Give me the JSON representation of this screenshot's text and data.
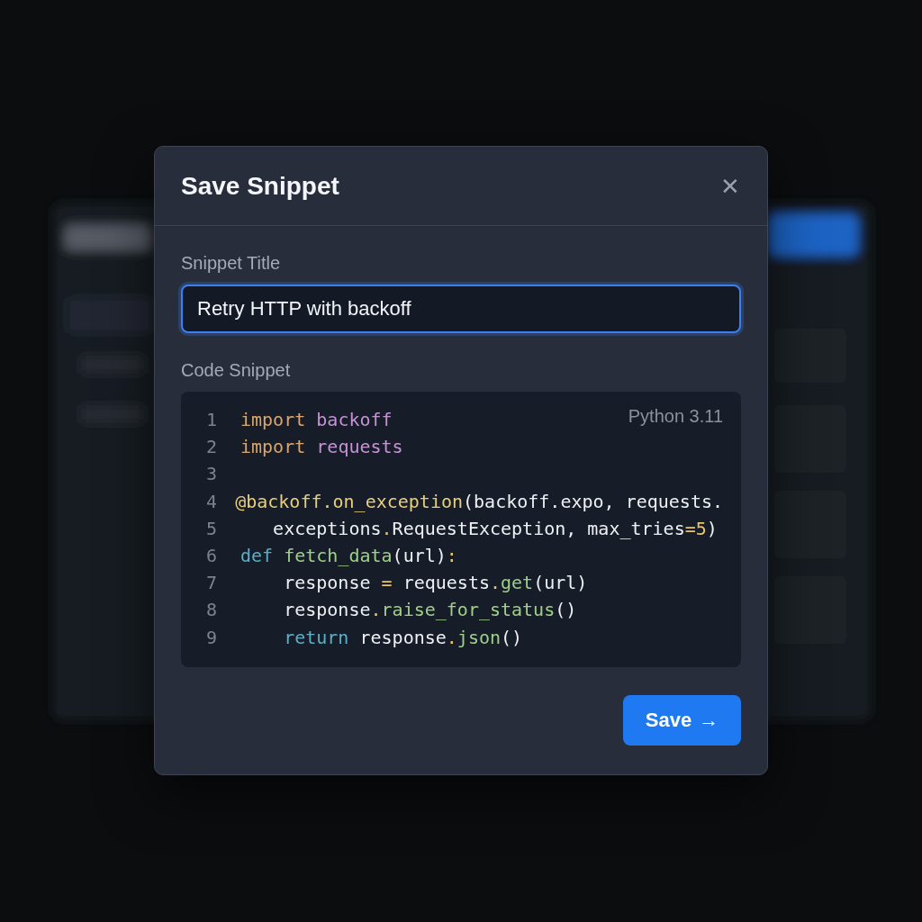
{
  "dialog": {
    "title": "Save Snippet",
    "close_label": "✕"
  },
  "title_field": {
    "label": "Snippet Title",
    "value": "Retry HTTP with backoff",
    "focused": true
  },
  "code_field": {
    "label": "Code Snippet",
    "language": "Python 3.11",
    "lines": [
      {
        "number": "1",
        "tokens": [
          {
            "kind": "keyword",
            "text": "import "
          },
          {
            "kind": "module",
            "text": "backoff"
          }
        ]
      },
      {
        "number": "2",
        "tokens": [
          {
            "kind": "keyword",
            "text": "import "
          },
          {
            "kind": "module",
            "text": "requests"
          }
        ]
      },
      {
        "number": "3"
      },
      {
        "number": "4",
        "tokens": [
          {
            "kind": "decorator",
            "text": "@backoff.on_exception"
          },
          {
            "kind": "plain",
            "text": "(backoff.expo, requests."
          }
        ]
      },
      {
        "number": "5",
        "tokens": [
          {
            "kind": "plain",
            "text": "   exceptions"
          },
          {
            "kind": "operator",
            "text": "."
          },
          {
            "kind": "plain",
            "text": "RequestException, max_tries"
          },
          {
            "kind": "operator",
            "text": "="
          },
          {
            "kind": "number",
            "text": "5"
          },
          {
            "kind": "plain",
            "text": ")"
          }
        ]
      },
      {
        "number": "6",
        "tokens": [
          {
            "kind": "control",
            "text": "def "
          },
          {
            "kind": "function",
            "text": "fetch_data"
          },
          {
            "kind": "plain",
            "text": "(url)"
          },
          {
            "kind": "operator",
            "text": ":"
          }
        ]
      },
      {
        "number": "7",
        "tokens": [
          {
            "kind": "plain",
            "text": "    response "
          },
          {
            "kind": "operator",
            "text": "="
          },
          {
            "kind": "plain",
            "text": " requests"
          },
          {
            "kind": "operator",
            "text": "."
          },
          {
            "kind": "function",
            "text": "get"
          },
          {
            "kind": "plain",
            "text": "(url)"
          }
        ]
      },
      {
        "number": "8",
        "tokens": [
          {
            "kind": "plain",
            "text": "    response"
          },
          {
            "kind": "operator",
            "text": "."
          },
          {
            "kind": "function",
            "text": "raise_for_status"
          },
          {
            "kind": "plain",
            "text": "()"
          }
        ]
      },
      {
        "number": "9",
        "tokens": [
          {
            "kind": "control",
            "text": "    return"
          },
          {
            "kind": "plain",
            "text": " response"
          },
          {
            "kind": "operator",
            "text": "."
          },
          {
            "kind": "function",
            "text": "json"
          },
          {
            "kind": "plain",
            "text": "()"
          }
        ]
      }
    ]
  },
  "save_button": {
    "label": "Save",
    "arrow": "→"
  }
}
